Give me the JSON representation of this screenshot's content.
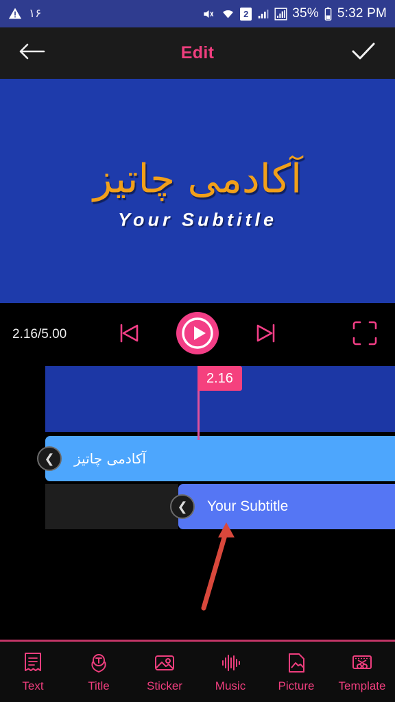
{
  "statusbar": {
    "warning_icon": "warning-triangle-icon",
    "notification_count": "۱۶",
    "mute_icon": "volume-mute-icon",
    "wifi_icon": "wifi-icon",
    "sim_label": "2",
    "signal1_icon": "signal-bars-icon",
    "signal2_icon": "signal-bars-boxed-icon",
    "battery_percent": "35%",
    "battery_icon": "battery-icon",
    "time": "5:32 PM"
  },
  "appbar": {
    "back_icon": "back-arrow-icon",
    "title": "Edit",
    "confirm_icon": "checkmark-icon"
  },
  "preview": {
    "title_text": "آکادمی چاتیز",
    "subtitle_text": "Your Subtitle",
    "background_color": "#1e3bab",
    "title_color": "#f2a01a",
    "subtitle_color": "#ffffff"
  },
  "player": {
    "time_display": "2.16/5.00",
    "current_time": "2.16",
    "total_time": "5.00",
    "prev_icon": "skip-previous-icon",
    "play_icon": "play-icon",
    "next_icon": "skip-next-icon",
    "fullscreen_icon": "fullscreen-icon",
    "accent_color": "#f33e86"
  },
  "timeline": {
    "playhead_time": "2.16",
    "playhead_color": "#f5417e",
    "video_track_color": "#1c37a5",
    "clips": [
      {
        "label": "آکادمی چاتیز",
        "color": "#4da6fd",
        "left_handle_icon": "chevron-left-handle-icon",
        "right_handle_icon": "chevron-right-handle-icon"
      },
      {
        "label": "Your Subtitle",
        "color": "#5576f4",
        "left_handle_icon": "chevron-left-handle-icon",
        "right_handle_icon": "chevron-right-handle-icon"
      }
    ],
    "annotation_arrow_color": "#d9483c"
  },
  "toolbar": {
    "accent_color": "#ef3e7e",
    "items": [
      {
        "label": "Text",
        "icon": "text-document-icon"
      },
      {
        "label": "Title",
        "icon": "title-laurel-icon"
      },
      {
        "label": "Sticker",
        "icon": "sticker-image-icon"
      },
      {
        "label": "Music",
        "icon": "music-waveform-icon"
      },
      {
        "label": "Picture",
        "icon": "picture-file-icon"
      },
      {
        "label": "Template",
        "icon": "template-filmstrip-icon"
      }
    ]
  }
}
